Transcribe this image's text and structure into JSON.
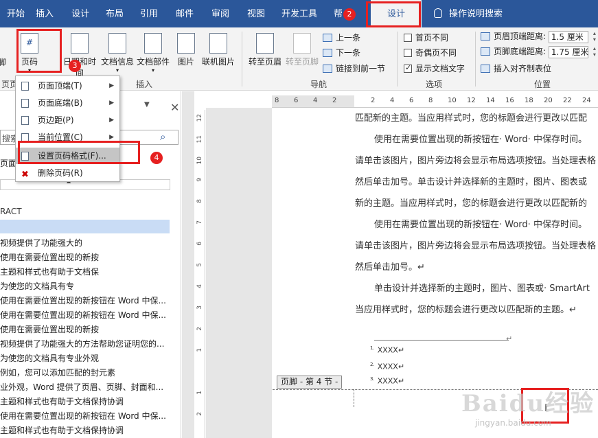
{
  "tabs": [
    "开始",
    "插入",
    "设计",
    "布局",
    "引用",
    "邮件",
    "审阅",
    "视图",
    "开发工具",
    "帮"
  ],
  "active_tab": "设计",
  "tell_me": "操作说明搜索",
  "ribbon": {
    "partial_footer": "脚",
    "page_number": "页码",
    "date_time": "日期和时间",
    "doc_info": "文档信息",
    "doc_parts": "文档部件",
    "picture": "图片",
    "online_picture": "联机图片",
    "insert_group": "插入",
    "goto_header": "转至页眉",
    "goto_footer": "转至页脚",
    "prev": "上一条",
    "next": "下一条",
    "link_prev": "链接到前一节",
    "nav_group": "导航",
    "diff_first": "首页不同",
    "diff_odd_even": "奇偶页不同",
    "show_text": "显示文档文字",
    "options_group": "选项",
    "header_dist_label": "页眉顶端距离:",
    "header_dist_value": "1.5 厘米",
    "footer_dist_label": "页脚底端距离:",
    "footer_dist_value": "1.75 厘米",
    "insert_align_tab": "插入对齐制表位",
    "position_group": "位置",
    "partial_left_group": "页页"
  },
  "menu": [
    "页面顶端(T)",
    "页面底端(B)",
    "页边距(P)",
    "当前位置(C)",
    "设置页码格式(F)...",
    "删除页码(R)"
  ],
  "nav_pane": {
    "search_placeholder": "搜索",
    "tab_partial": "页面",
    "heading_partial": "RACT",
    "items": [
      "视频提供了功能强大的",
      "使用在需要位置出现的新按",
      "主题和样式也有助于文档保",
      "为使您的文档具有专",
      "使用在需要位置出现的新按钮在 Word 中保...",
      "使用在需要位置出现的新按钮在 Word 中保...",
      "使用在需要位置出现的新按",
      "视频提供了功能强大的方法帮助您证明您的...",
      "为使您的文档具有专业外观",
      "例如，您可以添加匹配的封元素",
      "业外观，Word 提供了页眉、页脚、封面和...",
      "主题和样式也有助于文档保持协调",
      "使用在需要位置出现的新按钮在 Word 中保...",
      "主题和样式也有助于文档保持协调"
    ]
  },
  "ruler_numbers": [
    "8",
    "6",
    "4",
    "2",
    "",
    "2",
    "4",
    "6",
    "8",
    "10",
    "12",
    "14",
    "16",
    "18",
    "20",
    "22",
    "24"
  ],
  "vruler_numbers": [
    "12",
    "11",
    "10",
    "9",
    "8",
    "7",
    "6",
    "5",
    "4",
    "3",
    "2",
    "1",
    "",
    "1",
    "2"
  ],
  "document": {
    "lines": [
      "匹配新的主题。当应用样式时，您的标题会进行更改以匹配",
      "使用在需要位置出现的新按钮在· Word· 中保存时间。",
      "请单击该图片，图片旁边将会显示布局选项按钮。当处理表格",
      "然后单击加号。单击设计并选择新的主题时，图片、图表或",
      "新的主题。当应用样式时，您的标题会进行更改以匹配新的",
      "使用在需要位置出现的新按钮在· Word· 中保存时间。",
      "请单击该图片，图片旁边将会显示布局选项按钮。当处理表格",
      "然后单击加号。↵",
      "单击设计并选择新的主题时，图片、图表或· SmartArt",
      "当应用样式时，您的标题会进行更改以匹配新的主题。↵"
    ],
    "footnotes": [
      "XXXX↵",
      "XXXX↵",
      "XXXX↵"
    ],
    "footer_label": "页脚 - 第 4 节 -"
  },
  "badges": [
    "2",
    "3",
    "4"
  ],
  "watermark": {
    "brand": "Baidu经验",
    "url": "jingyan.baidu.com"
  },
  "accent_color": "#2b579a",
  "annotation_color": "#e62020"
}
